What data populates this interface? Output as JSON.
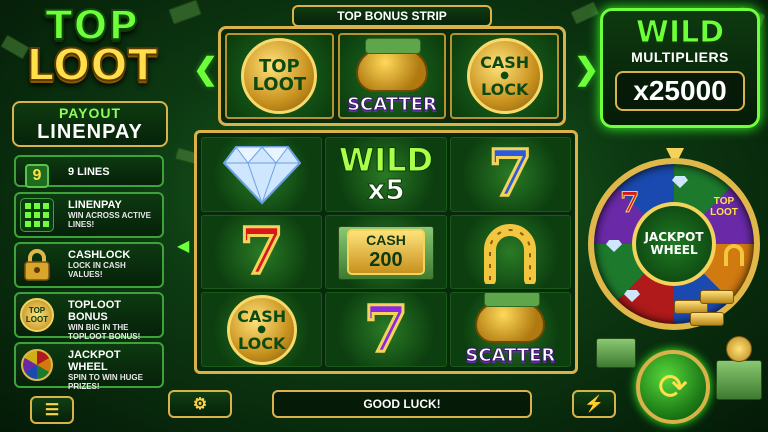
{
  "logo": {
    "line1": "TOP",
    "line2": "LOOT"
  },
  "payout": {
    "label": "PAYOUT",
    "value": "LINENPAY"
  },
  "info_panel": [
    {
      "title": "9 LINES",
      "desc": "",
      "badge": "9"
    },
    {
      "title": "LINENPAY",
      "desc": "WIN ACROSS ACTIVE LINES!"
    },
    {
      "title": "CASHLOCK",
      "desc": "LOCK IN CASH VALUES!"
    },
    {
      "title": "TOPLOOT BONUS",
      "desc": "WIN BIG IN THE TOPLOOT BONUS!",
      "icon_text": "TOP LOOT"
    },
    {
      "title": "JACKPOT WHEEL",
      "desc": "SPIN TO WIN HUGE PRIZES!"
    }
  ],
  "bonus_strip": {
    "title": "TOP BONUS STRIP",
    "cells": [
      {
        "symbol": "toploot-icon",
        "text1": "TOP",
        "text2": "LOOT"
      },
      {
        "symbol": "pot-of-gold-icon",
        "text1": "SCATTER"
      },
      {
        "symbol": "cash-lock-coin-icon",
        "text1": "CASH",
        "text2": "LOCK"
      }
    ]
  },
  "wild_multipliers": {
    "title": "WILD",
    "subtitle": "MULTIPLIERS",
    "value": "x25000"
  },
  "reels": {
    "row1": {
      "wild_text": "WILD",
      "wild_mult": "x5",
      "seven": "7"
    },
    "row2": {
      "seven": "7",
      "cash_label": "CASH",
      "cash_value": "200"
    },
    "row3": {
      "coin1": "CASH",
      "coin2": "LOCK",
      "seven": "7",
      "scatter": "SCATTER"
    }
  },
  "jackpot_wheel": {
    "hub_line1": "JACKPOT",
    "hub_line2": "WHEEL",
    "segment_text1": "TOP",
    "segment_text2": "LOOT",
    "seven": "7"
  },
  "bottom_bar": {
    "message": "GOOD LUCK!"
  },
  "colors": {
    "accent_green": "#6cff3a",
    "gold": "#d9b34a",
    "background": "#0d3a12"
  }
}
